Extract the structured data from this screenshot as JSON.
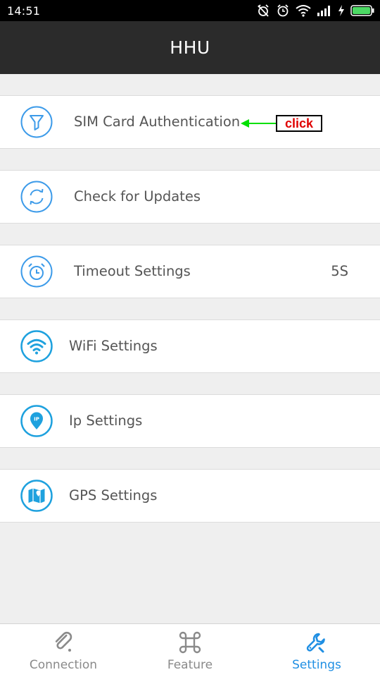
{
  "status_bar": {
    "time": "14:51",
    "icons": [
      "alarm-off-icon",
      "alarm-clock-icon",
      "wifi-icon",
      "signal-icon",
      "charging-icon",
      "battery-icon"
    ]
  },
  "app_bar": {
    "title": "HHU"
  },
  "settings": {
    "items": [
      {
        "label": "SIM Card Authentication",
        "icon": "filter-icon",
        "value": ""
      },
      {
        "label": "Check for Updates",
        "icon": "refresh-icon",
        "value": ""
      },
      {
        "label": "Timeout Settings",
        "icon": "alarm-clock-icon",
        "value": "5S"
      },
      {
        "label": "WiFi Settings",
        "icon": "wifi-icon",
        "value": ""
      },
      {
        "label": "Ip Settings",
        "icon": "ip-location-pin-icon",
        "value": ""
      },
      {
        "label": "GPS Settings",
        "icon": "map-icon",
        "value": ""
      }
    ]
  },
  "annotation": {
    "text": "click",
    "arrow_color": "#00e000",
    "text_color": "#e00000"
  },
  "tab_bar": {
    "tabs": [
      {
        "label": "Connection",
        "icon": "paperclip-icon",
        "active": false
      },
      {
        "label": "Feature",
        "icon": "command-icon",
        "active": false
      },
      {
        "label": "Settings",
        "icon": "wrench-icon",
        "active": true
      }
    ],
    "active_color": "#1f8fe3",
    "inactive_color": "#8a8a8a"
  },
  "colors": {
    "accent": "#1f8fe3",
    "icon_circle": "#1ea1de",
    "app_bar": "#2b2b2b"
  }
}
